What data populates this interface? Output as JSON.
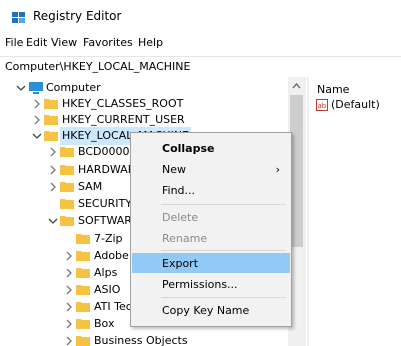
{
  "app": {
    "title": "Registry Editor"
  },
  "menu": [
    "File",
    "Edit",
    "View",
    "Favorites",
    "Help"
  ],
  "address": "Computer\\HKEY_LOCAL_MACHINE",
  "values_pane": {
    "column_header": "Name",
    "entries": [
      {
        "icon": "string-value-icon",
        "name": "(Default)"
      }
    ]
  },
  "tree": {
    "root": "Computer",
    "items": [
      {
        "label": "HKEY_CLASSES_ROOT"
      },
      {
        "label": "HKEY_CURRENT_USER"
      },
      {
        "label": "HKEY_LOCAL_MACHINE"
      },
      {
        "label": "BCD000000"
      },
      {
        "label": "HARDWAR"
      },
      {
        "label": "SAM"
      },
      {
        "label": "SECURITY"
      },
      {
        "label": "SOFTWAR"
      },
      {
        "label": "7-Zip"
      },
      {
        "label": "Adobe"
      },
      {
        "label": "Alps"
      },
      {
        "label": "ASIO"
      },
      {
        "label": "ATI Tec"
      },
      {
        "label": "Box"
      },
      {
        "label": "Business Objects"
      }
    ]
  },
  "context_menu": {
    "items": [
      {
        "label": "Collapse",
        "bold": true
      },
      {
        "label": "New",
        "submenu": "›"
      },
      {
        "label": "Find..."
      },
      {
        "label": "Delete",
        "disabled": true
      },
      {
        "label": "Rename",
        "disabled": true
      },
      {
        "label": "Export",
        "highlighted": true
      },
      {
        "label": "Permissions..."
      },
      {
        "label": "Copy Key Name"
      }
    ]
  },
  "colors": {
    "selection": "#cce8ff",
    "menu_highlight": "#91c9f7",
    "folder": "#f6c244",
    "computer_icon": "#2b8fd8"
  }
}
